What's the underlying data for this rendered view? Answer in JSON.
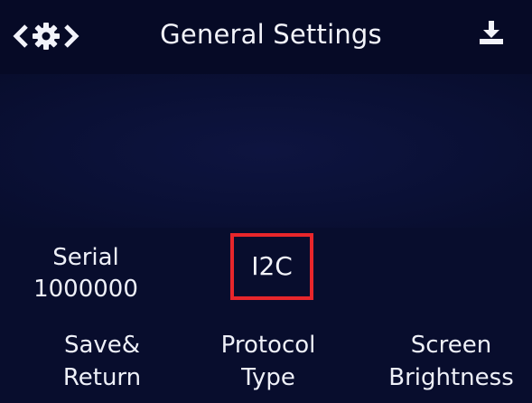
{
  "header": {
    "title": "General Settings",
    "nav_icons": [
      "chevron-left-icon",
      "gear-icon",
      "chevron-right-icon"
    ],
    "action_icon": "download-icon"
  },
  "settings": {
    "interface": {
      "line1": "Serial",
      "line2": "1000000"
    },
    "protocol": {
      "selected": "I2C"
    }
  },
  "softkeys": [
    {
      "line1": "Save&",
      "line2": "Return"
    },
    {
      "line1": "Protocol",
      "line2": "Type"
    },
    {
      "line1": "Screen",
      "line2": "Brightness"
    }
  ],
  "colors": {
    "screen_background": "#080d2d",
    "text": "#eef0f8",
    "selection_border": "#e8262b"
  }
}
